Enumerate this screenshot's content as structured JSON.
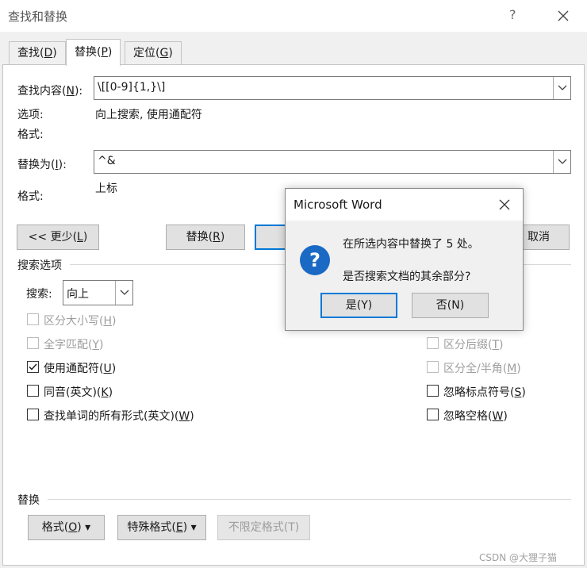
{
  "window": {
    "title": "查找和替换",
    "help_glyph": "?",
    "close_glyph": "✕"
  },
  "tabs": [
    {
      "label": "查找(",
      "key": "D",
      "tail": ")"
    },
    {
      "label": "替换(",
      "key": "P",
      "tail": ")"
    },
    {
      "label": "定位(",
      "key": "G",
      "tail": ")"
    }
  ],
  "find": {
    "label_pre": "查找内容(",
    "label_key": "N",
    "label_tail": "):",
    "value": "\\[[0-9]{1,}\\]",
    "options_label": "选项:",
    "options_value": "向上搜索, 使用通配符",
    "format_label": "格式:"
  },
  "replace": {
    "label_pre": "替换为(",
    "label_key": "I",
    "label_tail": "):",
    "value": "^&",
    "format_label": "格式:",
    "format_value": "上标"
  },
  "buttons": {
    "less_pre": "<< 更少(",
    "less_key": "L",
    "less_tail": ")",
    "replace_pre": "替换(",
    "replace_key": "R",
    "replace_tail": ")",
    "cancel": "取消"
  },
  "search_options": {
    "heading": "搜索选项",
    "search_label": "搜索:",
    "search_value": "向上"
  },
  "checkboxes_left": [
    {
      "pre": "区分大小写(",
      "key": "H",
      "tail": ")",
      "checked": false,
      "disabled": true
    },
    {
      "pre": "全字匹配(",
      "key": "Y",
      "tail": ")",
      "checked": false,
      "disabled": true
    },
    {
      "pre": "使用通配符(",
      "key": "U",
      "tail": ")",
      "checked": true,
      "disabled": false
    },
    {
      "pre": "同音(英文)(",
      "key": "K",
      "tail": ")",
      "checked": false,
      "disabled": false
    },
    {
      "pre": "查找单词的所有形式(英文)(",
      "key": "W",
      "tail": ")",
      "checked": false,
      "disabled": false
    }
  ],
  "checkboxes_right": [
    {
      "pre": "区分后缀(",
      "key": "T",
      "tail": ")",
      "checked": false,
      "disabled": true
    },
    {
      "pre": "区分全/半角(",
      "key": "M",
      "tail": ")",
      "checked": false,
      "disabled": true
    },
    {
      "pre": "忽略标点符号(",
      "key": "S",
      "tail": ")",
      "checked": false,
      "disabled": false
    },
    {
      "pre": "忽略空格(",
      "key": "W",
      "tail": ")",
      "checked": false,
      "disabled": false
    }
  ],
  "replace_section": {
    "heading": "替换",
    "format_pre": "格式(",
    "format_key": "O",
    "format_tail": ") ▾",
    "special_pre": "特殊格式(",
    "special_key": "E",
    "special_tail": ") ▾",
    "no_format": "不限定格式(T)"
  },
  "dialog": {
    "title": "Microsoft Word",
    "close_glyph": "✕",
    "icon_glyph": "?",
    "message_line1": "在所选内容中替换了 5 处。",
    "message_line2": "是否搜索文档的其余部分?",
    "yes_label": "是(Y)",
    "no_label": "否(N)"
  },
  "watermark": "CSDN @大狸子猫",
  "colors": {
    "accent": "#0078d7",
    "icon_blue": "#1a69c4",
    "background": "#f0f0f0"
  }
}
